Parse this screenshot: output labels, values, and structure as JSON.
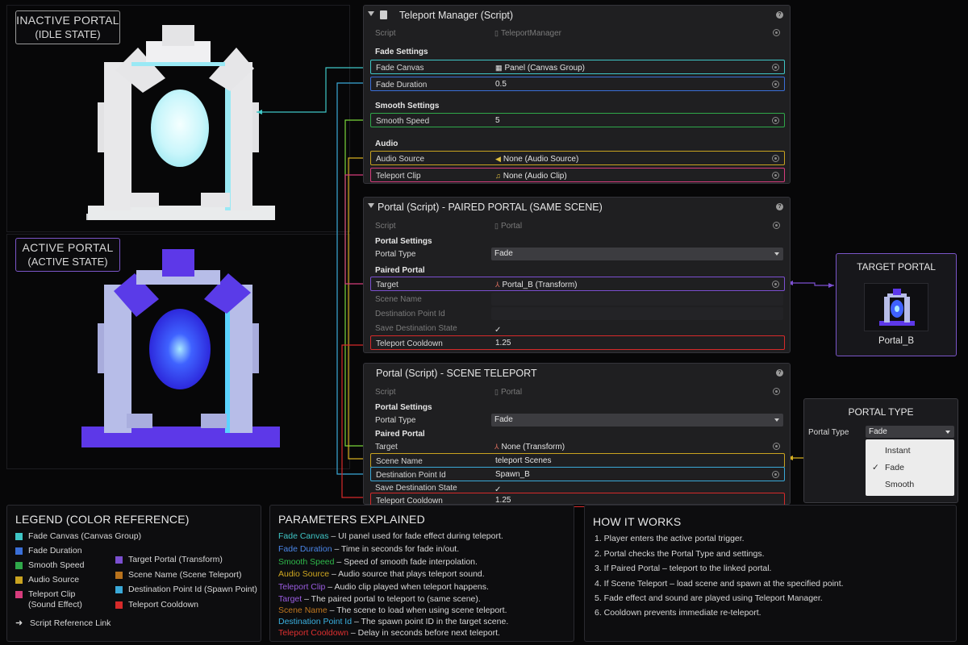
{
  "left": {
    "inactive": {
      "line1": "INACTIVE PORTAL",
      "line2": "(IDLE STATE)"
    },
    "active": {
      "line1": "ACTIVE PORTAL",
      "line2": "(ACTIVE STATE)"
    }
  },
  "teleport_manager": {
    "title": "Teleport Manager (Script)",
    "script_label": "Script",
    "script_value": "TeleportManager",
    "fade_settings": "Fade Settings",
    "fade_canvas_label": "Fade Canvas",
    "fade_canvas_value": "Panel (Canvas Group)",
    "fade_duration_label": "Fade Duration",
    "fade_duration_value": "0.5",
    "smooth_settings": "Smooth Settings",
    "smooth_speed_label": "Smooth Speed",
    "smooth_speed_value": "5",
    "audio": "Audio",
    "audio_source_label": "Audio Source",
    "audio_source_value": "None (Audio Source)",
    "teleport_clip_label": "Teleport Clip",
    "teleport_clip_value": "None (Audio Clip)"
  },
  "portal_paired": {
    "title": "Portal (Script) - PAIRED PORTAL (SAME SCENE)",
    "script_label": "Script",
    "script_value": "Portal",
    "portal_settings": "Portal Settings",
    "portal_type_label": "Portal Type",
    "portal_type_value": "Fade",
    "paired_portal": "Paired Portal",
    "target_label": "Target",
    "target_value": "Portal_B (Transform)",
    "scene_name_label": "Scene Name",
    "dest_point_label": "Destination Point Id",
    "save_dest_label": "Save Destination State",
    "cooldown_label": "Teleport Cooldown",
    "cooldown_value": "1.25"
  },
  "portal_scene": {
    "title": "Portal (Script) - SCENE TELEPORT",
    "script_label": "Script",
    "script_value": "Portal",
    "portal_settings": "Portal Settings",
    "portal_type_label": "Portal Type",
    "portal_type_value": "Fade",
    "paired_portal": "Paired Portal",
    "target_label": "Target",
    "target_value": "None (Transform)",
    "scene_name_label": "Scene Name",
    "scene_name_value": "teleport Scenes",
    "dest_point_label": "Destination Point Id",
    "dest_point_value": "Spawn_B",
    "save_dest_label": "Save Destination State",
    "cooldown_label": "Teleport Cooldown",
    "cooldown_value": "1.25"
  },
  "target_portal": {
    "title": "TARGET PORTAL",
    "name": "Portal_B"
  },
  "portal_type_box": {
    "title": "PORTAL TYPE",
    "label": "Portal Type",
    "selected": "Fade",
    "options": [
      "Instant",
      "Fade",
      "Smooth"
    ]
  },
  "legend": {
    "title": "LEGEND (COLOR REFERENCE)",
    "left": [
      {
        "label": "Fade Canvas (Canvas Group)",
        "color": "#3fc6c6"
      },
      {
        "label": "Fade Duration",
        "color": "#3a6fd8"
      },
      {
        "label": "Smooth Speed",
        "color": "#2fa84a"
      },
      {
        "label": "Audio Source",
        "color": "#c9a320"
      },
      {
        "label": "Teleport Clip",
        "label2": "(Sound Effect)",
        "color": "#d63c7c"
      }
    ],
    "right": [
      {
        "label": "Target Portal (Transform)",
        "color": "#7b4fd0"
      },
      {
        "label": "Scene Name (Scene Teleport)",
        "color": "#b8721c"
      },
      {
        "label": "Destination Point Id (Spawn Point)",
        "color": "#3aa9d8"
      },
      {
        "label": "Teleport Cooldown",
        "color": "#d62a2a"
      }
    ],
    "link": "Script Reference Link"
  },
  "params": {
    "title": "PARAMETERS EXPLAINED",
    "items": [
      {
        "name": "Fade Canvas",
        "desc": "–  UI panel used for fade effect during teleport.",
        "color": "#3fc6c6"
      },
      {
        "name": "Fade Duration",
        "desc": "–  Time in seconds for fade in/out.",
        "color": "#4a86e8"
      },
      {
        "name": "Smooth Speed",
        "desc": "–  Speed of smooth fade interpolation.",
        "color": "#2fb84a"
      },
      {
        "name": "Audio Source",
        "desc": "–  Audio source that plays teleport sound.",
        "color": "#d0a820"
      },
      {
        "name": "Teleport Clip",
        "desc": "–  Audio clip played when teleport happens.",
        "color": "#9a5ce0"
      },
      {
        "name": "Target",
        "desc": "–  The paired portal to teleport to (same scene).",
        "color": "#9a5ce0"
      },
      {
        "name": "Scene Name",
        "desc": "–  The scene to load when using scene teleport.",
        "color": "#c07820"
      },
      {
        "name": "Destination Point Id",
        "desc": "–  The spawn point ID in the target scene.",
        "color": "#3ab0e0"
      },
      {
        "name": "Teleport Cooldown",
        "desc": "–  Delay in seconds before next teleport.",
        "color": "#e03030"
      }
    ]
  },
  "how": {
    "title": "HOW IT WORKS",
    "steps": [
      "1.   Player enters the active portal trigger.",
      "2.   Portal checks the Portal Type and settings.",
      "3.   If Paired Portal – teleport to the linked portal.",
      "4.   If Scene Teleport – load scene and spawn at the specified point.",
      "5.   Fade effect and sound are played using Teleport Manager.",
      "6.   Cooldown prevents immediate re-teleport."
    ]
  }
}
